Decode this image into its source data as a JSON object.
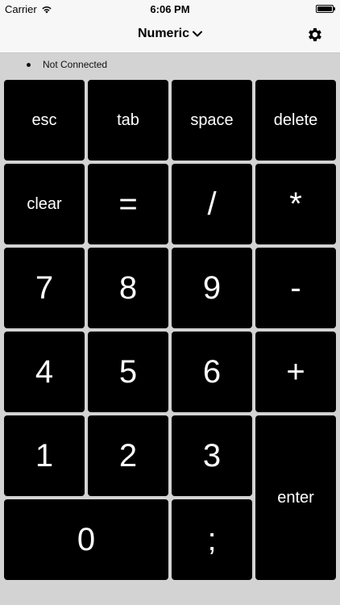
{
  "status_bar": {
    "carrier": "Carrier",
    "time": "6:06 PM",
    "icons": [
      "wifi-icon",
      "battery-icon"
    ]
  },
  "nav_bar": {
    "title": "Numeric",
    "title_icon": "chevron-down-icon",
    "right_icon": "gear-icon"
  },
  "connection": {
    "status": "Not Connected"
  },
  "keys": {
    "esc": "esc",
    "tab": "tab",
    "space": "space",
    "delete": "delete",
    "clear": "clear",
    "equals": "=",
    "slash": "/",
    "asterisk": "*",
    "seven": "7",
    "eight": "8",
    "nine": "9",
    "minus": "-",
    "four": "4",
    "five": "5",
    "six": "6",
    "plus": "+",
    "one": "1",
    "two": "2",
    "three": "3",
    "enter": "enter",
    "zero": "0",
    "semicolon": ";"
  },
  "colors": {
    "key_background": "#000000",
    "key_text": "#ffffff",
    "keypad_background": "#d3d3d3"
  }
}
